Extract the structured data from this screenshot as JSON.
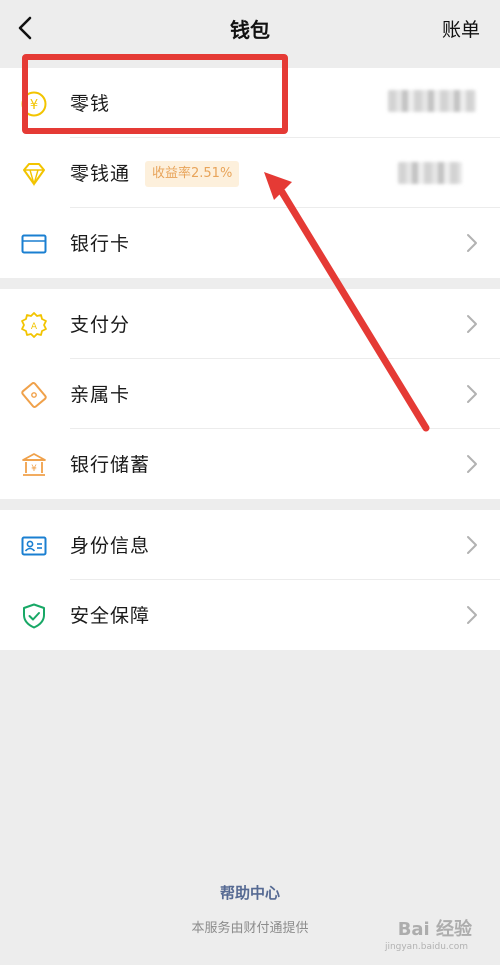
{
  "header": {
    "title": "钱包",
    "bill_label": "账单"
  },
  "groups": [
    {
      "items": [
        {
          "label": "零钱",
          "icon": "yuan-coin-icon"
        },
        {
          "label": "零钱通",
          "icon": "diamond-icon",
          "badge": "收益率2.51%"
        },
        {
          "label": "银行卡",
          "icon": "bank-card-icon"
        }
      ]
    },
    {
      "items": [
        {
          "label": "支付分",
          "icon": "score-badge-icon"
        },
        {
          "label": "亲属卡",
          "icon": "family-card-icon"
        },
        {
          "label": "银行储蓄",
          "icon": "bank-building-icon"
        }
      ]
    },
    {
      "items": [
        {
          "label": "身份信息",
          "icon": "id-card-icon"
        },
        {
          "label": "安全保障",
          "icon": "shield-check-icon"
        }
      ]
    }
  ],
  "footer": {
    "help_label": "帮助中心",
    "provider_text": "本服务由财付通提供"
  },
  "watermark": {
    "text": "Bai 经验",
    "sub": "jingyan.baidu.com"
  },
  "colors": {
    "background": "#ededed",
    "yellow_icon": "#f2c400",
    "orange_icon": "#f0a14a",
    "blue_icon": "#1a7fd1",
    "green_icon": "#18a866",
    "annotation_red": "#e53a35",
    "badge_text": "#e8a45a",
    "help_link": "#566a93"
  }
}
